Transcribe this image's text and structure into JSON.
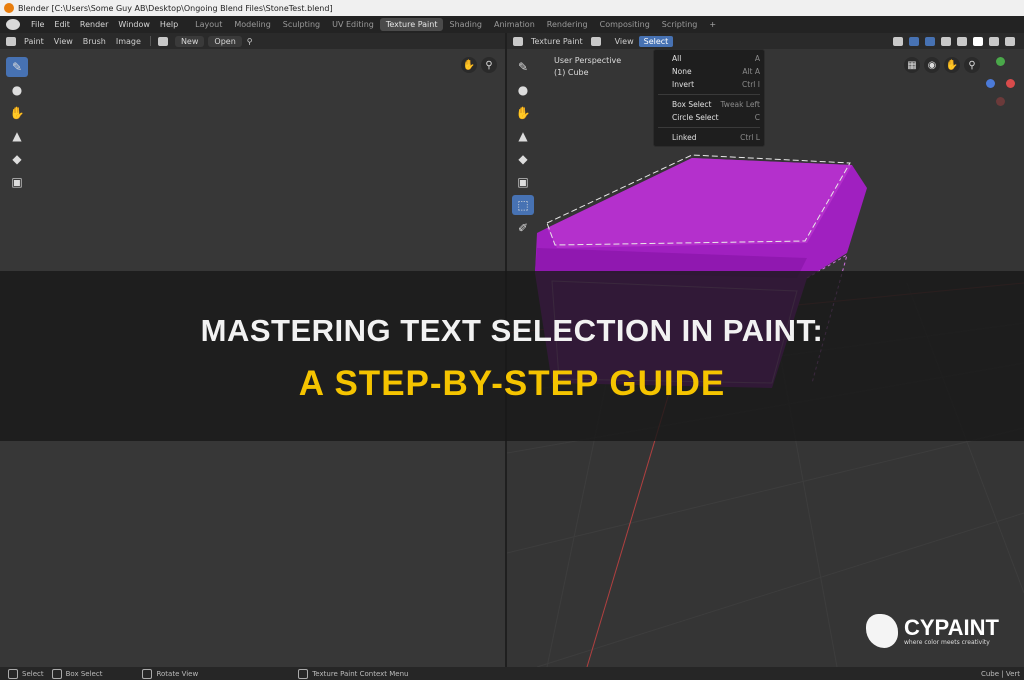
{
  "window_title": "Blender [C:\\Users\\Some Guy AB\\Desktop\\Ongoing Blend Files\\StoneTest.blend]",
  "main_menu": [
    "File",
    "Edit",
    "Render",
    "Window",
    "Help"
  ],
  "workspace_tabs": [
    "Layout",
    "Modeling",
    "Sculpting",
    "UV Editing",
    "Texture Paint",
    "Shading",
    "Animation",
    "Rendering",
    "Compositing",
    "Scripting"
  ],
  "workspace_active": "Texture Paint",
  "workspace_add": "+",
  "image_editor": {
    "mode": "Paint",
    "menus": [
      "View",
      "Brush",
      "Image"
    ],
    "new_label": "New",
    "open_label": "Open"
  },
  "viewport": {
    "mode": "Texture Paint",
    "menus": [
      "View",
      "Select"
    ],
    "perspective": "User Perspective",
    "object": "(1) Cube"
  },
  "select_menu": {
    "items": [
      {
        "label": "All",
        "shortcut": "A"
      },
      {
        "label": "None",
        "shortcut": "Alt A"
      },
      {
        "label": "Invert",
        "shortcut": "Ctrl I"
      },
      {
        "label": "Box Select",
        "shortcut": "Tweak Left"
      },
      {
        "label": "Circle Select",
        "shortcut": "C"
      },
      {
        "label": "Linked",
        "shortcut": "Ctrl L"
      }
    ]
  },
  "banner": {
    "line1": "MASTERING TEXT SELECTION IN PAINT:",
    "line2": "A STEP-BY-STEP GUIDE"
  },
  "brand": {
    "name": "CYPAINT",
    "tagline": "where color meets creativity"
  },
  "status_bar": {
    "items": [
      "Select",
      "Box Select",
      "Rotate View",
      "Texture Paint Context Menu"
    ],
    "right": "Cube | Vert"
  },
  "colors": {
    "cube": "#a020c0",
    "accent": "#4772b3",
    "banner_title": "#f5c400"
  }
}
